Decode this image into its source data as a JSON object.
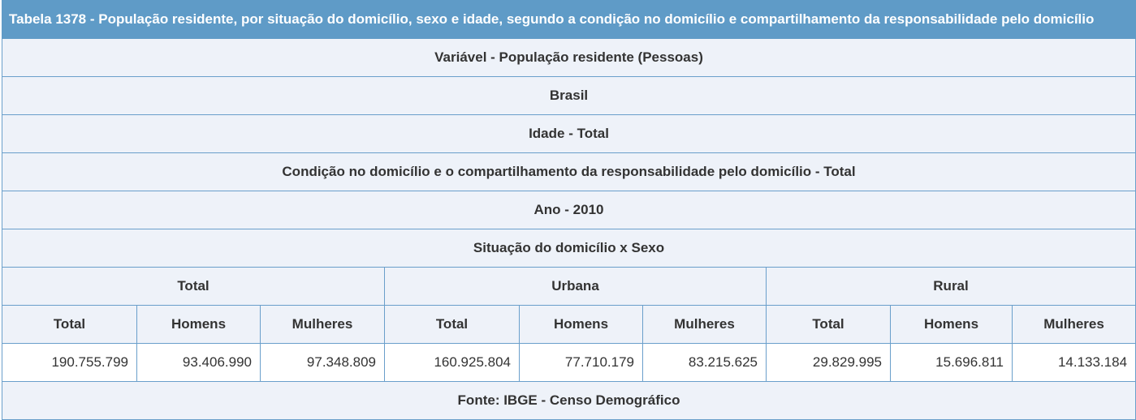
{
  "title": "Tabela 1378 - População residente, por situação do domicílio, sexo e idade, segundo a condição no domicílio e compartilhamento da responsabilidade pelo domicílio",
  "header_rows": [
    "Variável - População residente (Pessoas)",
    "Brasil",
    "Idade - Total",
    "Condição no domicílio e o compartilhamento da responsabilidade pelo domicílio - Total",
    "Ano - 2010",
    "Situação do domicílio x Sexo"
  ],
  "groups": [
    "Total",
    "Urbana",
    "Rural"
  ],
  "subcolumns": [
    "Total",
    "Homens",
    "Mulheres",
    "Total",
    "Homens",
    "Mulheres",
    "Total",
    "Homens",
    "Mulheres"
  ],
  "values": [
    "190.755.799",
    "93.406.990",
    "97.348.809",
    "160.925.804",
    "77.710.179",
    "83.215.625",
    "29.829.995",
    "15.696.811",
    "14.133.184"
  ],
  "footer": "Fonte: IBGE - Censo Demográfico"
}
